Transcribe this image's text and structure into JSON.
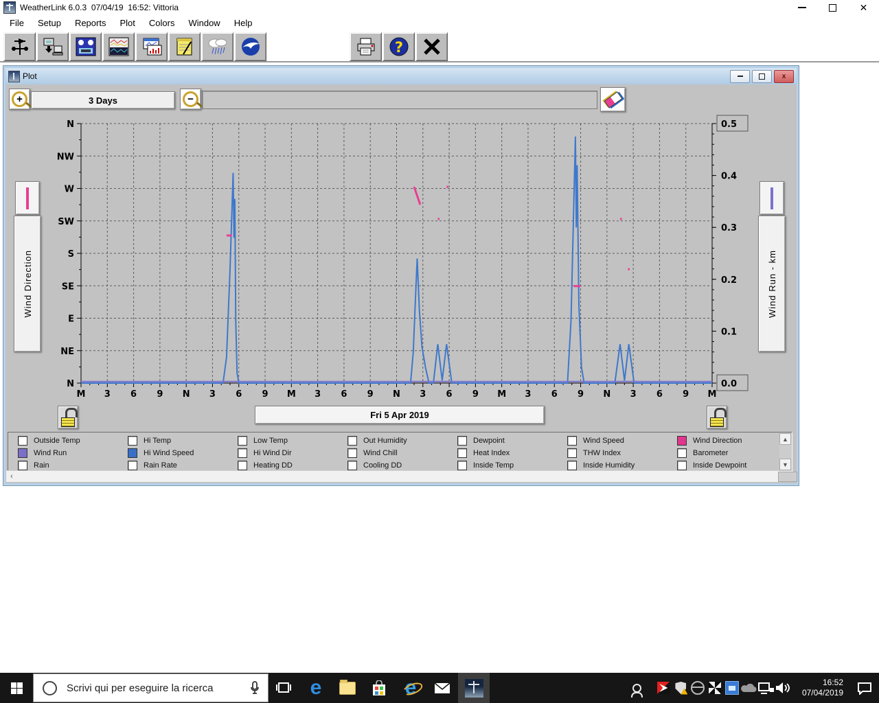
{
  "app": {
    "title": "WeatherLink 6.0.3  07/04/19  16:52: Vittoria"
  },
  "menu": {
    "items": [
      "File",
      "Setup",
      "Reports",
      "Plot",
      "Colors",
      "Window",
      "Help"
    ]
  },
  "toolbar": {
    "icons": [
      "weather-station",
      "download",
      "bulletin",
      "plot",
      "report",
      "notes",
      "rain",
      "noaa",
      "print",
      "help",
      "close"
    ]
  },
  "plot_window": {
    "title": "Plot",
    "range_label": "3 Days",
    "date_label": "Fri 5 Apr 2019",
    "left_series": {
      "label": "Wind Direction",
      "color": "#e83f92"
    },
    "right_series": {
      "label": "Wind Run - km",
      "color": "#7b72cf"
    }
  },
  "chart_data": {
    "type": "line",
    "grid": "dashed",
    "x_axis": {
      "hours_span": 72,
      "tick_step_hours": 3,
      "tick_labels": [
        "M",
        "3",
        "6",
        "9",
        "N",
        "3",
        "6",
        "9",
        "M",
        "3",
        "6",
        "9",
        "N",
        "3",
        "6",
        "9",
        "M",
        "3",
        "6",
        "9",
        "N",
        "3",
        "6",
        "9",
        "M"
      ]
    },
    "left_axis": {
      "label": "Wind Direction",
      "tick_labels": [
        "N",
        "NW",
        "W",
        "SW",
        "S",
        "SE",
        "E",
        "NE",
        "N"
      ]
    },
    "right_axis": {
      "label": "Wind Run - km",
      "range": [
        0,
        0.5
      ],
      "tick_labels": [
        "0.5",
        "0.4",
        "0.3",
        "0.2",
        "0.1",
        "0.0"
      ],
      "boxed_label_indexes": [
        0,
        5
      ]
    },
    "series": [
      {
        "name": "Hi Wind Speed",
        "color": "#3e78cc",
        "axis": "right",
        "points": [
          [
            0,
            0
          ],
          [
            16.2,
            0
          ],
          [
            16.6,
            0.05
          ],
          [
            17.0,
            0.22
          ],
          [
            17.35,
            0.405
          ],
          [
            17.45,
            0.28
          ],
          [
            17.55,
            0.355
          ],
          [
            17.65,
            0.12
          ],
          [
            17.8,
            0.02
          ],
          [
            18.0,
            0
          ],
          [
            37.6,
            0
          ],
          [
            37.9,
            0.06
          ],
          [
            38.15,
            0.16
          ],
          [
            38.35,
            0.24
          ],
          [
            38.6,
            0.14
          ],
          [
            38.9,
            0.07
          ],
          [
            39.3,
            0.03
          ],
          [
            39.7,
            0
          ],
          [
            40.2,
            0
          ],
          [
            40.7,
            0.075
          ],
          [
            41.2,
            0.005
          ],
          [
            41.7,
            0.075
          ],
          [
            42.3,
            0
          ],
          [
            55.5,
            0
          ],
          [
            55.9,
            0.12
          ],
          [
            56.2,
            0.33
          ],
          [
            56.4,
            0.475
          ],
          [
            56.5,
            0.3
          ],
          [
            56.6,
            0.42
          ],
          [
            56.8,
            0.15
          ],
          [
            57.1,
            0.03
          ],
          [
            57.4,
            0
          ],
          [
            60.9,
            0
          ],
          [
            61.5,
            0.075
          ],
          [
            62.0,
            0.005
          ],
          [
            62.5,
            0.075
          ],
          [
            63.1,
            0
          ],
          [
            72,
            0
          ]
        ]
      },
      {
        "name": "Wind Run",
        "color": "#7b72cf",
        "axis": "right",
        "points": [
          [
            0,
            0.003
          ],
          [
            72,
            0.003
          ]
        ]
      },
      {
        "name": "Wind Direction",
        "color": "#e83f92",
        "axis": "direction",
        "marks": [
          {
            "h1": 16.6,
            "h2": 17.2,
            "d1": 3.45,
            "d2": 3.45
          },
          {
            "h1": 38.0,
            "h2": 38.7,
            "d1": 1.95,
            "d2": 2.5
          },
          {
            "h1": 40.7,
            "h2": 40.9,
            "d1": 2.94,
            "d2": 2.94
          },
          {
            "h1": 41.7,
            "h2": 41.9,
            "d1": 1.95,
            "d2": 1.95
          },
          {
            "h1": 56.2,
            "h2": 57.0,
            "d1": 5.01,
            "d2": 5.01
          },
          {
            "h1": 61.5,
            "h2": 61.7,
            "d1": 2.94,
            "d2": 2.94
          },
          {
            "h1": 62.4,
            "h2": 62.6,
            "d1": 4.49,
            "d2": 4.49
          }
        ]
      }
    ]
  },
  "checkbox_panel": {
    "columns": [
      [
        {
          "label": "Outside Temp",
          "checked": false
        },
        {
          "label": "Wind Run",
          "checked": true,
          "color": "#7a70c8"
        },
        {
          "label": "Rain",
          "checked": false
        }
      ],
      [
        {
          "label": "Hi Temp",
          "checked": false
        },
        {
          "label": "Hi Wind Speed",
          "checked": true,
          "color": "#3a6fc8"
        },
        {
          "label": "Rain Rate",
          "checked": false
        }
      ],
      [
        {
          "label": "Low Temp",
          "checked": false
        },
        {
          "label": "Hi Wind Dir",
          "checked": false
        },
        {
          "label": "Heating DD",
          "checked": false
        }
      ],
      [
        {
          "label": "Out Humidity",
          "checked": false
        },
        {
          "label": "Wind Chill",
          "checked": false
        },
        {
          "label": "Cooling DD",
          "checked": false
        }
      ],
      [
        {
          "label": "Dewpoint",
          "checked": false
        },
        {
          "label": "Heat Index",
          "checked": false
        },
        {
          "label": "Inside Temp",
          "checked": false
        }
      ],
      [
        {
          "label": "Wind Speed",
          "checked": false
        },
        {
          "label": "THW Index",
          "checked": false
        },
        {
          "label": "Inside Humidity",
          "checked": false
        }
      ],
      [
        {
          "label": "Wind Direction",
          "checked": true,
          "color": "#e0368e"
        },
        {
          "label": "Barometer",
          "checked": false
        },
        {
          "label": "Inside Dewpoint",
          "checked": false
        }
      ]
    ]
  },
  "taskbar": {
    "search_placeholder": "Scrivi qui per eseguire la ricerca",
    "apps": [
      "edge",
      "file-explorer",
      "store",
      "internet-explorer",
      "mail",
      "weatherlink"
    ],
    "tray": [
      "people",
      "kaspersky",
      "defender",
      "browser",
      "pinwheel",
      "remote-app",
      "onedrive",
      "network",
      "volume"
    ],
    "time": "16:52",
    "date": "07/04/2019"
  }
}
